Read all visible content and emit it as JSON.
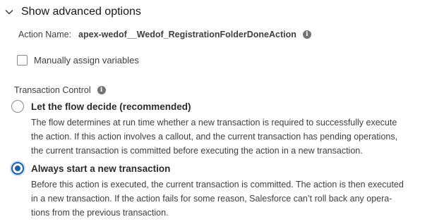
{
  "advanced": {
    "title": "Show advanced options",
    "icon": "chevron-down-icon"
  },
  "action": {
    "label": "Action Name:",
    "value": "apex-wedof__Wedof_RegistrationFolderDoneAction",
    "info_icon": "i"
  },
  "assign": {
    "label": "Manually assign variables",
    "checked": false
  },
  "transaction": {
    "header": "Transaction Control",
    "info_icon": "i",
    "options": [
      {
        "label": "Let the flow decide (recommended)",
        "selected": false,
        "description": [
          "The flow determines at run time whether a new transaction is required to successfully execute",
          "the action. If this action involves a callout, and the current transaction has pending operations,",
          "the current transaction is committed before executing the action in a new transaction."
        ]
      },
      {
        "label": "Always start a new transaction",
        "selected": true,
        "description": [
          "Before this action is executed, the current transaction is committed. The action is then executed",
          "in a new transaction. If the action fails for some reason, Salesforce can’t roll back any opera-",
          "tions from the previous transaction."
        ]
      }
    ]
  }
}
